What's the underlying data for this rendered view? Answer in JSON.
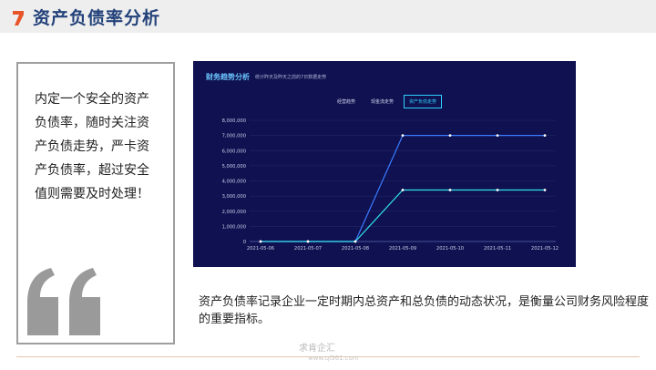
{
  "header": {
    "title": "资产负债率分析"
  },
  "quote": {
    "text": "内定一个安全的资产负债率，随时关注资产负债走势，严卡资产负债率，超过安全值则需要及时处理！"
  },
  "dashboard": {
    "title": "财务趋势分析",
    "subtitle": "统计昨天及昨天之前的7日数据走势",
    "tabs": [
      "经营趋势",
      "现金流走势",
      "资产负债走势"
    ],
    "active_tab": "资产负债走势"
  },
  "description": "资产负债率记录企业一定时期内总资产和总负债的动态状况，是衡量公司财务风险程度的重要指标。",
  "watermark": {
    "brand": "求肯企汇",
    "url": "www.ql361.com"
  },
  "colors": {
    "title": "#23427a",
    "logo": "#e8542a",
    "panel": "#0f1150",
    "series_1": "#3b7bff",
    "series_2": "#33e0ea"
  },
  "chart_data": {
    "type": "line",
    "categories": [
      "2021-05-06",
      "2021-05-07",
      "2021-05-08",
      "2021-05-09",
      "2021-05-10",
      "2021-05-11",
      "2021-05-12"
    ],
    "y_ticks": [
      "0",
      "1,000,000",
      "2,000,000",
      "3,000,000",
      "4,000,000",
      "5,000,000",
      "6,000,000",
      "7,000,000",
      "8,000,000"
    ],
    "ylim": [
      0,
      8000000
    ],
    "grid": true,
    "series": [
      {
        "values": [
          0,
          0,
          0,
          7000000,
          7000000,
          7000000,
          7000000
        ],
        "color": "#3b7bff"
      },
      {
        "values": [
          0,
          0,
          0,
          3400000,
          3400000,
          3400000,
          3400000
        ],
        "color": "#33e0ea"
      }
    ]
  }
}
